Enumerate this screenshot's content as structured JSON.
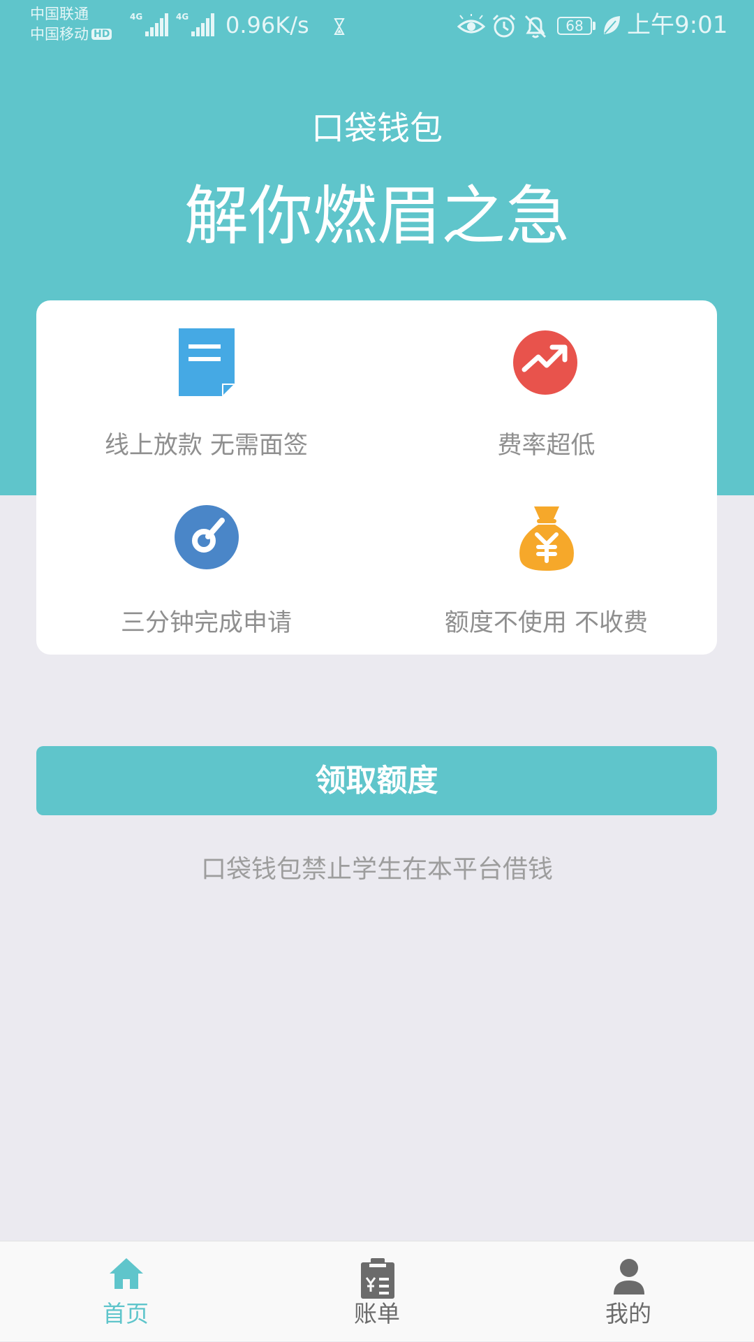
{
  "status_bar": {
    "carrier_1": "中国联通",
    "carrier_2": "中国移动",
    "hd_badge": "HD",
    "signal_tag_1": "4G",
    "signal_tag_2": "4G",
    "net_speed": "0.96K/s",
    "battery": "68",
    "time": "上午9:01",
    "icons": [
      "hourglass-icon",
      "eye-icon",
      "alarm-icon",
      "bell-off-icon",
      "leaf-icon"
    ]
  },
  "header": {
    "app_title": "口袋钱包",
    "slogan": "解你燃眉之急"
  },
  "features": [
    {
      "label": "线上放款 无需面签",
      "icon": "document-icon",
      "color": "#45a9e4"
    },
    {
      "label": "费率超低",
      "icon": "trend-up-icon",
      "color": "#e8534c"
    },
    {
      "label": "三分钟完成申请",
      "icon": "speed-dial-icon",
      "color": "#4a86c8"
    },
    {
      "label": "额度不使用 不收费",
      "icon": "money-bag-icon",
      "color": "#f6a82a"
    }
  ],
  "cta": {
    "label": "领取额度"
  },
  "disclaimer": "口袋钱包禁止学生在本平台借钱",
  "nav": {
    "items": [
      {
        "label": "首页",
        "icon": "home-icon",
        "active": true
      },
      {
        "label": "账单",
        "icon": "bill-icon",
        "active": false
      },
      {
        "label": "我的",
        "icon": "user-icon",
        "active": false
      }
    ]
  },
  "colors": {
    "accent": "#5fc5cb",
    "page_background": "#ebeaf0",
    "muted_text": "#8f8f8f",
    "nav_inactive": "#6b6b6b"
  }
}
